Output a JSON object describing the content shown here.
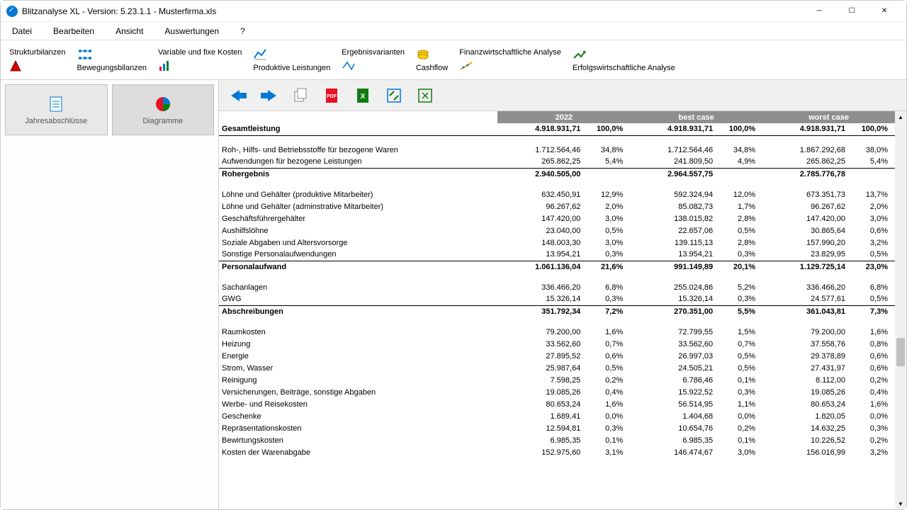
{
  "window": {
    "title": "Blitzanalyse XL - Version: 5.23.1.1 - Musterfirma.xls"
  },
  "menu": {
    "datei": "Datei",
    "bearbeiten": "Bearbeiten",
    "ansicht": "Ansicht",
    "auswertungen": "Auswertungen",
    "help": "?"
  },
  "toolbar": {
    "strukturbilanzen": "Strukturbilanzen",
    "bewegungsbilanzen": "Bewegungsbilanzen",
    "variable_fixe": "Variable und fixe Kosten",
    "produktive": "Produktive Leistungen",
    "ergebnisvarianten": "Ergebnisvarianten",
    "cashflow": "Cashflow",
    "finanz": "Finanzwirtschaftliche Analyse",
    "erfolg": "Erfolgswirtschaftliche Analyse"
  },
  "side": {
    "jahres": "Jahresabschlüsse",
    "diagramme": "Diagramme"
  },
  "headers": {
    "c1": "2022",
    "c2": "best case",
    "c3": "worst case"
  },
  "rows": [
    {
      "label": "Gesamtleistung",
      "v1": "4.918.931,71",
      "p1": "100,0%",
      "v2": "4.918.931,71",
      "p2": "100,0%",
      "v3": "4.918.931,71",
      "p3": "100,0%",
      "bold": true,
      "topsum": true
    },
    {
      "spacer": true
    },
    {
      "label": "Roh-, Hilfs- und Betriebsstoffe für bezogene Waren",
      "v1": "1.712.564,46",
      "p1": "34,8%",
      "v2": "1.712.564,46",
      "p2": "34,8%",
      "v3": "1.867.292,68",
      "p3": "38,0%"
    },
    {
      "label": "Aufwendungen für bezogene Leistungen",
      "v1": "265.862,25",
      "p1": "5,4%",
      "v2": "241.809,50",
      "p2": "4,9%",
      "v3": "265.862,25",
      "p3": "5,4%"
    },
    {
      "label": "Rohergebnis",
      "v1": "2.940.505,00",
      "p1": "",
      "v2": "2.964.557,75",
      "p2": "",
      "v3": "2.785.776,78",
      "p3": "",
      "bold": true,
      "sum": true
    },
    {
      "spacer": true
    },
    {
      "label": "Löhne und Gehälter (produktive Mitarbeiter)",
      "v1": "632.450,91",
      "p1": "12,9%",
      "v2": "592.324,94",
      "p2": "12,0%",
      "v3": "673.351,73",
      "p3": "13,7%"
    },
    {
      "label": "Löhne und Gehälter (adminstrative Mitarbeiter)",
      "v1": "96.267,62",
      "p1": "2,0%",
      "v2": "85.082,73",
      "p2": "1,7%",
      "v3": "96.267,62",
      "p3": "2,0%"
    },
    {
      "label": "Geschäftsführergehälter",
      "v1": "147.420,00",
      "p1": "3,0%",
      "v2": "138.015,82",
      "p2": "2,8%",
      "v3": "147.420,00",
      "p3": "3,0%"
    },
    {
      "label": "Aushilfslöhne",
      "v1": "23.040,00",
      "p1": "0,5%",
      "v2": "22.657,06",
      "p2": "0,5%",
      "v3": "30.865,64",
      "p3": "0,6%"
    },
    {
      "label": "Soziale Abgaben und Altersvorsorge",
      "v1": "148.003,30",
      "p1": "3,0%",
      "v2": "139.115,13",
      "p2": "2,8%",
      "v3": "157.990,20",
      "p3": "3,2%"
    },
    {
      "label": "Sonstige Personalaufwendungen",
      "v1": "13.954,21",
      "p1": "0,3%",
      "v2": "13.954,21",
      "p2": "0,3%",
      "v3": "23.829,95",
      "p3": "0,5%"
    },
    {
      "label": "Personalaufwand",
      "v1": "1.061.136,04",
      "p1": "21,6%",
      "v2": "991.149,89",
      "p2": "20,1%",
      "v3": "1.129.725,14",
      "p3": "23,0%",
      "bold": true,
      "sum": true
    },
    {
      "spacer": true
    },
    {
      "label": "Sachanlagen",
      "v1": "336.466,20",
      "p1": "6,8%",
      "v2": "255.024,86",
      "p2": "5,2%",
      "v3": "336.466,20",
      "p3": "6,8%"
    },
    {
      "label": "GWG",
      "v1": "15.326,14",
      "p1": "0,3%",
      "v2": "15.326,14",
      "p2": "0,3%",
      "v3": "24.577,61",
      "p3": "0,5%"
    },
    {
      "label": "Abschreibungen",
      "v1": "351.792,34",
      "p1": "7,2%",
      "v2": "270.351,00",
      "p2": "5,5%",
      "v3": "361.043,81",
      "p3": "7,3%",
      "bold": true,
      "sum": true
    },
    {
      "spacer": true
    },
    {
      "label": "Raumkosten",
      "v1": "79.200,00",
      "p1": "1,6%",
      "v2": "72.799,55",
      "p2": "1,5%",
      "v3": "79.200,00",
      "p3": "1,6%"
    },
    {
      "label": "Heizung",
      "v1": "33.562,60",
      "p1": "0,7%",
      "v2": "33.562,60",
      "p2": "0,7%",
      "v3": "37.558,76",
      "p3": "0,8%"
    },
    {
      "label": "Energie",
      "v1": "27.895,52",
      "p1": "0,6%",
      "v2": "26.997,03",
      "p2": "0,5%",
      "v3": "29.378,89",
      "p3": "0,6%"
    },
    {
      "label": "Strom, Wasser",
      "v1": "25.987,64",
      "p1": "0,5%",
      "v2": "24.505,21",
      "p2": "0,5%",
      "v3": "27.431,97",
      "p3": "0,6%"
    },
    {
      "label": "Reinigung",
      "v1": "7.598,25",
      "p1": "0,2%",
      "v2": "6.786,46",
      "p2": "0,1%",
      "v3": "8.112,00",
      "p3": "0,2%"
    },
    {
      "label": "Versicherungen, Beiträge, sonstige Abgaben",
      "v1": "19.085,26",
      "p1": "0,4%",
      "v2": "15.922,52",
      "p2": "0,3%",
      "v3": "19.085,26",
      "p3": "0,4%"
    },
    {
      "label": "Werbe- und Reisekosten",
      "v1": "80.653,24",
      "p1": "1,6%",
      "v2": "56.514,95",
      "p2": "1,1%",
      "v3": "80.653,24",
      "p3": "1,6%"
    },
    {
      "label": "Geschenke",
      "v1": "1.689,41",
      "p1": "0,0%",
      "v2": "1.404,68",
      "p2": "0,0%",
      "v3": "1.820,05",
      "p3": "0,0%"
    },
    {
      "label": "Repräsentationskosten",
      "v1": "12.594,81",
      "p1": "0,3%",
      "v2": "10.654,76",
      "p2": "0,2%",
      "v3": "14.632,25",
      "p3": "0,3%"
    },
    {
      "label": "Bewirtungskosten",
      "v1": "6.985,35",
      "p1": "0,1%",
      "v2": "6.985,35",
      "p2": "0,1%",
      "v3": "10.226,52",
      "p3": "0,2%"
    },
    {
      "label": "Kosten der Warenabgabe",
      "v1": "152.975,60",
      "p1": "3,1%",
      "v2": "146.474,67",
      "p2": "3,0%",
      "v3": "156.016,99",
      "p3": "3,2%"
    }
  ]
}
